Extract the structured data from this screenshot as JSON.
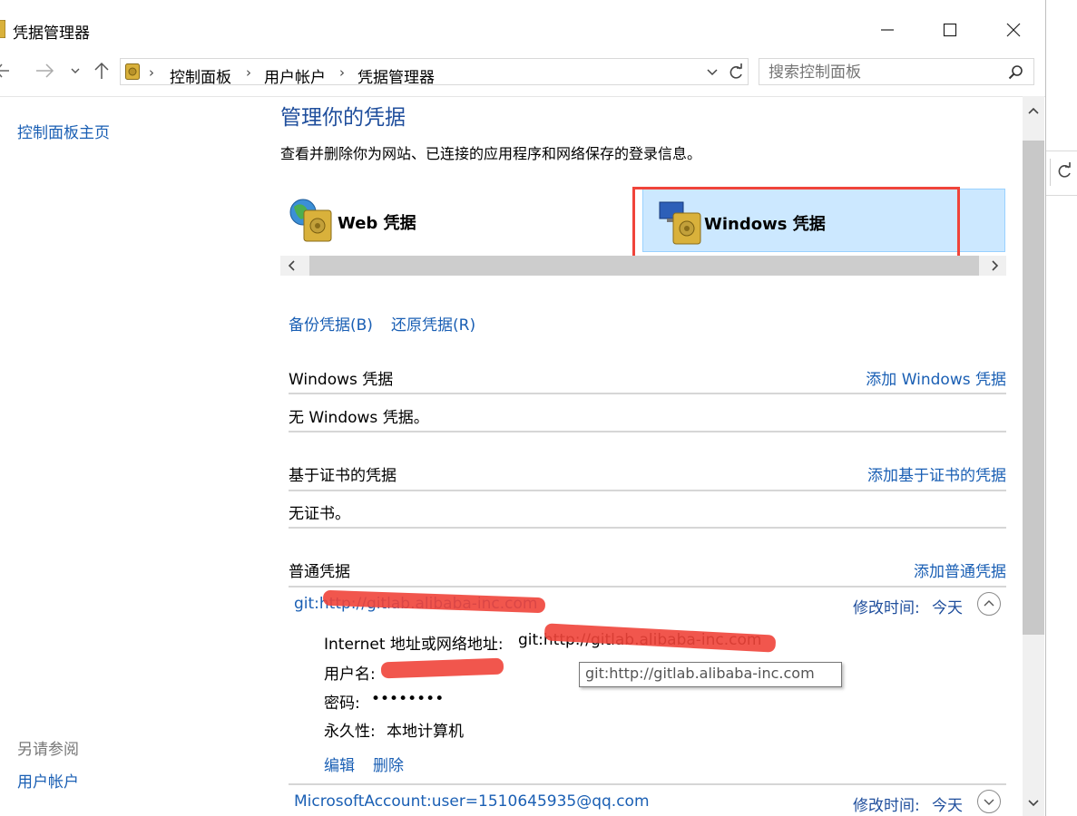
{
  "window": {
    "title": "凭据管理器"
  },
  "nav": {
    "breadcrumbs": [
      "控制面板",
      "用户帐户",
      "凭据管理器"
    ],
    "search_placeholder": "搜索控制面板"
  },
  "sidebar": {
    "home": "控制面板主页",
    "see_also": "另请参阅",
    "see_also_items": [
      "用户帐户"
    ]
  },
  "main": {
    "heading": "管理你的凭据",
    "description": "查看并删除你为网站、已连接的应用程序和网络保存的登录信息。",
    "tabs": [
      {
        "label": "Web 凭据"
      },
      {
        "label": "Windows 凭据"
      }
    ],
    "backup_link": "备份凭据(B)",
    "restore_link": "还原凭据(R)",
    "sections": {
      "windows": {
        "title": "Windows 凭据",
        "add": "添加 Windows 凭据",
        "empty": "无 Windows 凭据。"
      },
      "cert": {
        "title": "基于证书的凭据",
        "add": "添加基于证书的凭据",
        "empty": "无证书。"
      },
      "generic": {
        "title": "普通凭据",
        "add": "添加普通凭据"
      }
    },
    "credentials": [
      {
        "name": "git:http://gitlab.alibaba-inc.com",
        "modified_label": "修改时间:",
        "modified_value": "今天",
        "internet_label": "Internet 地址或网络地址:",
        "internet_value": "git:http://gitlab.alibaba-inc.com",
        "user_label": "用户名:",
        "user_value": "",
        "password_label": "密码:",
        "password_value": "••••••••",
        "persistence_label": "永久性:",
        "persistence_value": "本地计算机",
        "edit": "编辑",
        "delete": "删除"
      },
      {
        "name": "MicrosoftAccount:user=1510645935@qq.com",
        "modified_label": "修改时间:",
        "modified_value": "今天"
      }
    ],
    "tooltip": "git:http://gitlab.alibaba-inc.com"
  },
  "colors": {
    "link": "#1a5fb4",
    "heading": "#1f4e9c",
    "tab_selected_bg": "#cce8ff",
    "annotation": "#f0443a"
  }
}
